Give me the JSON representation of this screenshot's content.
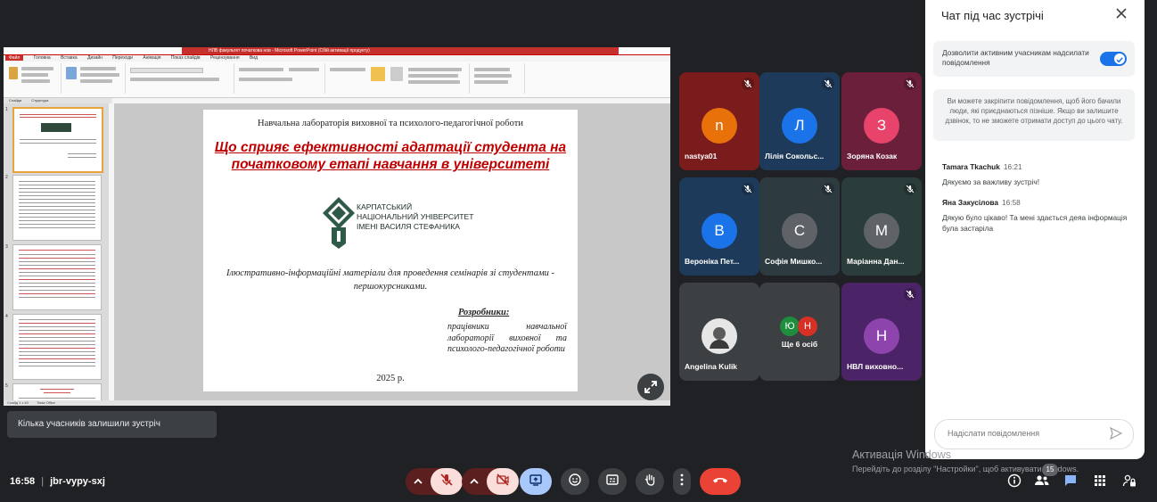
{
  "presentation": {
    "window_title": "НЛВ факультет початкова нов - Microsoft PowerPoint (Сбій активації продукту)",
    "menu": [
      "Файл",
      "Головна",
      "Вставка",
      "Дизайн",
      "Переходи",
      "Анімація",
      "Показ слайдів",
      "Рецензування",
      "Вид"
    ],
    "tabs": [
      "Слайди",
      "Структура"
    ],
    "status": [
      "Слайд 1 з 40",
      "Тема Office"
    ],
    "slide": {
      "lab": "Навчальна лабораторія виховної та психолого-педагогічної роботи",
      "title_line1": "Що сприяє ефективності адаптації студента на",
      "title_line2": "початковому етапі навчання в університеті",
      "univ_line1": "КАРПАТСЬКИЙ",
      "univ_line2": "НАЦІОНАЛЬНИЙ УНІВЕРСИТЕТ",
      "univ_line3": "ІМЕНІ ВАСИЛЯ СТЕФАНИКА",
      "desc": "Ілюстративно-інформаційні матеріали для проведення семінарів зі студентами - першокурсниками.",
      "developers_label": "Розробники:",
      "developers_text": "працівники навчальної лабораторії виховної та психолого-педагогічної роботи",
      "year": "2025 р."
    }
  },
  "participants": [
    {
      "initial": "n",
      "name": "nastya01",
      "color": "#e8710a",
      "bg": "#7b1c1c"
    },
    {
      "initial": "Л",
      "name": "Лілія Сокольс...",
      "color": "#1a73e8",
      "bg": "#1e3a5a"
    },
    {
      "initial": "З",
      "name": "Зоряна Козак",
      "color": "#e8436b",
      "bg": "#6b1f3a"
    },
    {
      "initial": "В",
      "name": "Вероніка Пет...",
      "color": "#1a73e8",
      "bg": "#1e3a5a"
    },
    {
      "initial": "С",
      "name": "Софія Мишко...",
      "color": "#5f6368",
      "bg": "#2d3a40"
    },
    {
      "initial": "М",
      "name": "Маріанна Дан...",
      "color": "#5f6368",
      "bg": "#2a3d3a"
    },
    {
      "initial": "",
      "name": "Angelina Kulik",
      "color": "#ddd",
      "bg": "#3c4043"
    },
    {
      "initial": "",
      "name": "Ще 6 осіб",
      "color": "#3c4043",
      "bg": "#3c4043"
    },
    {
      "initial": "Н",
      "name": "НВЛ виховно...",
      "color": "#8e44ad",
      "bg": "#4a2466"
    }
  ],
  "more": {
    "a": "Ю",
    "b": "Н"
  },
  "chat": {
    "title": "Чат під час зустрічі",
    "toggle_label": "Дозволити активним учасникам надсилати повідомлення",
    "info": "Ви можете закріпити повідомлення, щоб його бачили люди, які приєднаються пізніше. Якщо ви залишите дзвінок, то не зможете отримати доступ до цього чату.",
    "messages": [
      {
        "author": "Tamara Tkachuk",
        "time": "16:21",
        "text": "Дякуємо за важливу зустріч!"
      },
      {
        "author": "Яна Закусілова",
        "time": "16:58",
        "text": "Дякую було цікаво! Та мені здається деяа інформація була застаріла"
      }
    ],
    "placeholder": "Надіслати повідомлення"
  },
  "toast": "Кілька учасників залишили зустріч",
  "meeting": {
    "time": "16:58",
    "code": "jbr-vypy-sxj",
    "participants_badge": "15"
  },
  "watermark": {
    "line1": "Активація Windows",
    "line2": "Перейдіть до розділу \"Настройки\", щоб активувати Windows."
  }
}
